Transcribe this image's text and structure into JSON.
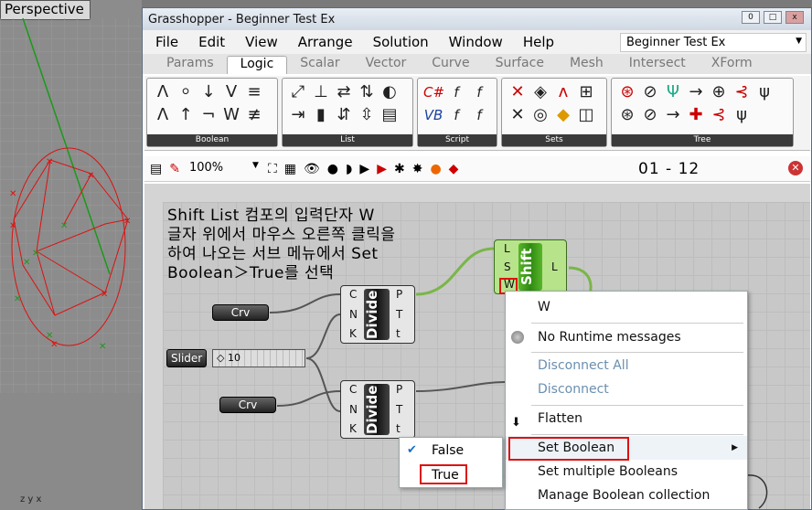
{
  "viewport": {
    "label": "Perspective",
    "axes": "z  y  x"
  },
  "window": {
    "title": "Grasshopper - Beginner Test Ex",
    "min": "0",
    "max": "□",
    "close": "x"
  },
  "menu": [
    "File",
    "Edit",
    "View",
    "Arrange",
    "Solution",
    "Window",
    "Help"
  ],
  "document_selector": "Beginner Test Ex",
  "tabs": [
    "Params",
    "Logic",
    "Scalar",
    "Vector",
    "Curve",
    "Surface",
    "Mesh",
    "Intersect",
    "XForm"
  ],
  "active_tab": "Logic",
  "groups": [
    {
      "label": "Boolean",
      "icons": [
        "Λ",
        "⸰",
        "↓",
        "V",
        "≡",
        "Λ",
        "↑",
        "¬",
        "W",
        "≢"
      ]
    },
    {
      "label": "List",
      "icons": [
        "⤢",
        "⊥",
        "⇄",
        "⇅",
        "◐",
        "⇥",
        "▮",
        "⇵",
        "⇳",
        "▤"
      ]
    },
    {
      "label": "Script",
      "icons": [
        "C#",
        "f",
        "f",
        "VB",
        "f",
        "f"
      ]
    },
    {
      "label": "Sets",
      "icons": [
        "✕",
        "◈",
        "ʌ",
        "⊞",
        "✕",
        "◎",
        "◆",
        "◫"
      ]
    },
    {
      "label": "Tree",
      "icons": [
        "⊛",
        "⊘",
        "Ψ",
        "→",
        "⊕",
        "⊰",
        "ψ",
        "⊛",
        "⊘",
        "→",
        "✚",
        "⊰",
        "ψ"
      ]
    }
  ],
  "canvas_toolbar": {
    "zoom": "100%",
    "file_title": "01 - 12"
  },
  "note_text": [
    "Shift List 컴포의 입력단자 W",
    "글자 위에서 마우스 오른쪽 클릭을",
    "하여 나오는 서브 메뉴에서 Set",
    "Boolean＞True를 선택"
  ],
  "nodes": {
    "crv1": "Crv",
    "crv2": "Crv",
    "slider_label": "Slider",
    "slider_value": "◇ 10",
    "divide1": {
      "name": "Divide",
      "inputs": [
        "C",
        "N",
        "K"
      ],
      "outputs": [
        "P",
        "T",
        "t"
      ]
    },
    "divide2": {
      "name": "Divide",
      "inputs": [
        "C",
        "N",
        "K"
      ],
      "outputs": [
        "P",
        "T",
        "t"
      ]
    },
    "shift": {
      "name": "Shift",
      "inputs": [
        "L",
        "S",
        "W"
      ],
      "outputs": [
        "L"
      ]
    }
  },
  "context_menu": {
    "header": "W",
    "items": [
      "No Runtime messages",
      "Disconnect All",
      "Disconnect",
      "Flatten",
      "Set Boolean",
      "Set multiple Booleans",
      "Manage Boolean collection"
    ]
  },
  "submenu": {
    "items": [
      "False",
      "True"
    ]
  }
}
